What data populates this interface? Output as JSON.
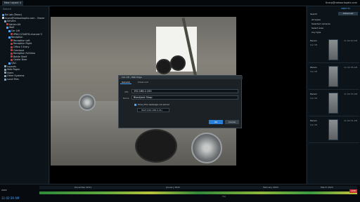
{
  "topbar": {
    "tab_label": "New Layout 4",
    "right_text": "Xcorp@networkoptix.com"
  },
  "left": {
    "search_placeholder": "Search",
    "tree": [
      {
        "label": "Nx Lab (Teoxc)"
      },
      {
        "label": "Xcorp@networkoptix.com - Owner"
      },
      {
        "label": "Servers"
      },
      {
        "label": "Adrian-Kit"
      },
      {
        "label": "Wolf"
      },
      {
        "label": "Car Lift"
      },
      {
        "label": "IPNV-1234878-channel 3"
      },
      {
        "label": "Reception"
      },
      {
        "label": "Reception Left"
      },
      {
        "label": "Reception Right"
      },
      {
        "label": "Office 3 Entry"
      },
      {
        "label": "Overland"
      },
      {
        "label": "Reception FullView"
      },
      {
        "label": "Bottle Shelf"
      },
      {
        "label": "Cooler Door"
      },
      {
        "label": "Q&C"
      },
      {
        "label": "Layouts"
      },
      {
        "label": "Web Pages"
      },
      {
        "label": "Users"
      },
      {
        "label": "Other Systems"
      },
      {
        "label": "Local Files"
      }
    ]
  },
  "dialog": {
    "title": "Car Lift - Web Page",
    "tabs": [
      "General",
      "Advanced"
    ],
    "url_label": "URL",
    "url_value": "192.168.2.100",
    "name_label": "Name",
    "name_value": "Blackjack Shop",
    "proxy_label": "Proxy this webpage via server",
    "server_value": "Wolf (192.168.2.21)",
    "ok_label": "OK",
    "cancel_label": "Cancel"
  },
  "right": {
    "header": "OBJECTS",
    "search_label": "Search",
    "advanced_label": "Advanced",
    "filter1": "All types",
    "filter2": "Selected cameras",
    "filter3": "Select area",
    "filter4": "Any type",
    "events": [
      {
        "type": "Person",
        "camera": "Car lift",
        "time": "11:02:40 AM"
      },
      {
        "type": "Person",
        "camera": "Car lift",
        "time": "11:02:38 AM"
      },
      {
        "type": "Person",
        "camera": "Car lift",
        "time": "11:02:33 AM"
      },
      {
        "type": "Person",
        "camera": "Car lift",
        "time": "11:02:31 AM"
      }
    ]
  },
  "timeline": {
    "date": "2022",
    "months": [
      "December 2021",
      "January 2022",
      "February 2022",
      "March 2022"
    ],
    "ticks": [
      "Feb"
    ],
    "current_time": "11:02:39 AM",
    "live_label": "LIVE"
  },
  "colors": {
    "accent": "#4aa3ff",
    "ok_button": "#2a7fd8"
  }
}
